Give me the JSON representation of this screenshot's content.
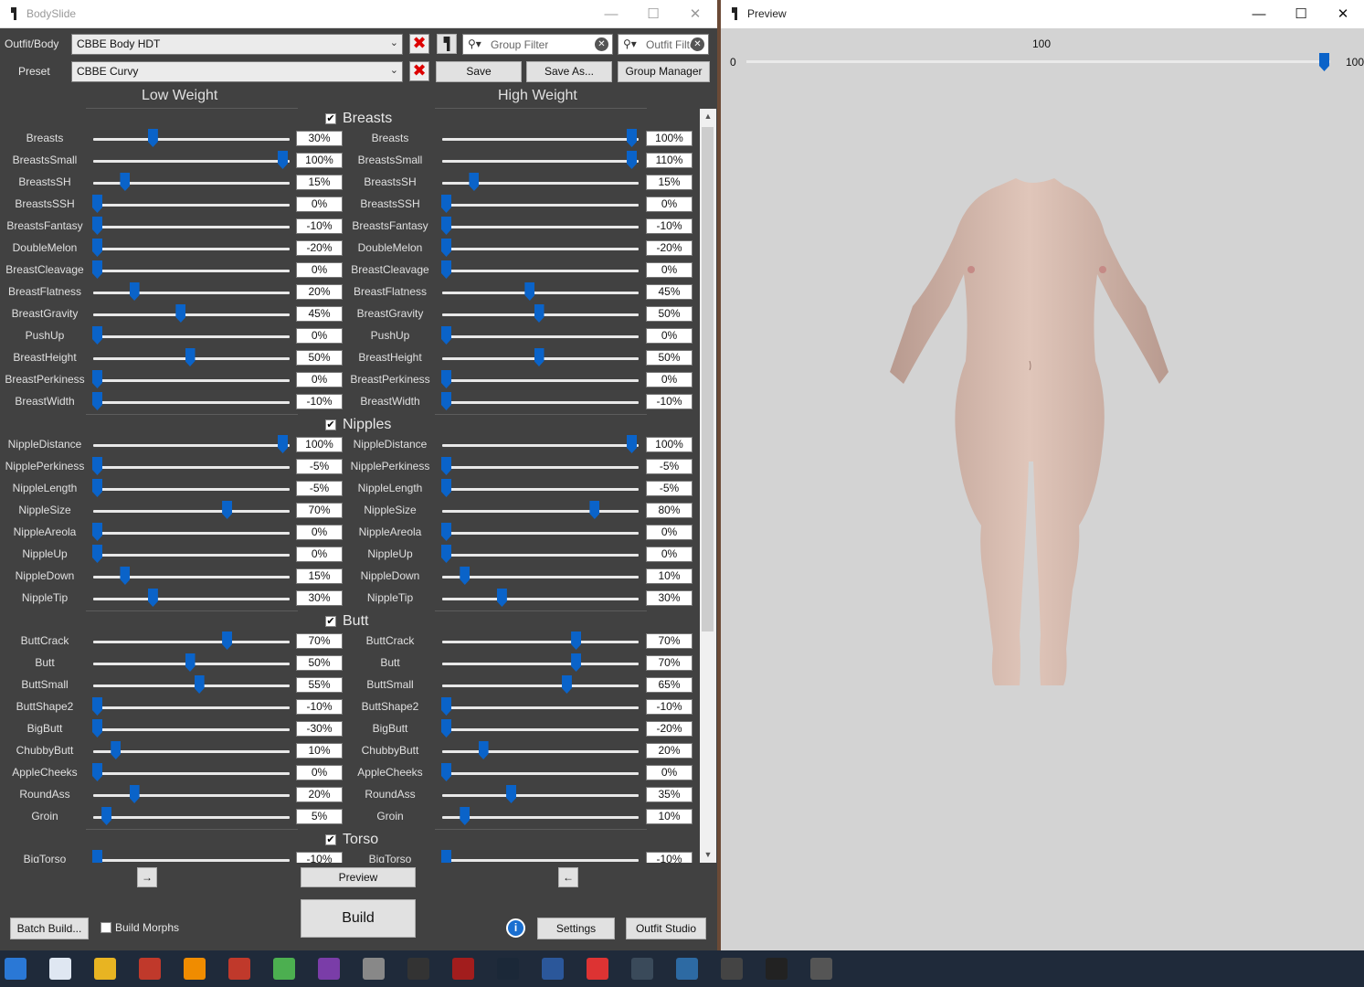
{
  "bodyslide": {
    "title": "BodySlide",
    "outfit_label": "Outfit/Body",
    "outfit_value": "CBBE Body HDT",
    "preset_label": "Preset",
    "preset_value": "CBBE Curvy",
    "group_filter_placeholder": "Group Filter",
    "outfit_filter_placeholder": "Outfit Filter",
    "save": "Save",
    "save_as": "Save As...",
    "group_manager": "Group Manager",
    "low_weight": "Low Weight",
    "high_weight": "High Weight",
    "preview_button": "Preview",
    "build_button": "Build",
    "batch_build": "Batch Build...",
    "build_morphs": "Build Morphs",
    "settings": "Settings",
    "outfit_studio": "Outfit Studio",
    "arrow_right": "→",
    "arrow_left": "←",
    "info": "i"
  },
  "sections": [
    {
      "name": "Breasts",
      "sliders": [
        {
          "name": "Breasts",
          "low": 30,
          "high": 100
        },
        {
          "name": "BreastsSmall",
          "low": 100,
          "high": 110
        },
        {
          "name": "BreastsSH",
          "low": 15,
          "high": 15
        },
        {
          "name": "BreastsSSH",
          "low": 0,
          "high": 0
        },
        {
          "name": "BreastsFantasy",
          "low": -10,
          "high": -10
        },
        {
          "name": "DoubleMelon",
          "low": -20,
          "high": -20
        },
        {
          "name": "BreastCleavage",
          "low": 0,
          "high": 0
        },
        {
          "name": "BreastFlatness",
          "low": 20,
          "high": 45
        },
        {
          "name": "BreastGravity",
          "low": 45,
          "high": 50
        },
        {
          "name": "PushUp",
          "low": 0,
          "high": 0
        },
        {
          "name": "BreastHeight",
          "low": 50,
          "high": 50
        },
        {
          "name": "BreastPerkiness",
          "low": 0,
          "high": 0
        },
        {
          "name": "BreastWidth",
          "low": -10,
          "high": -10
        }
      ]
    },
    {
      "name": "Nipples",
      "sliders": [
        {
          "name": "NippleDistance",
          "low": 100,
          "high": 100
        },
        {
          "name": "NipplePerkiness",
          "low": -5,
          "high": -5
        },
        {
          "name": "NippleLength",
          "low": -5,
          "high": -5
        },
        {
          "name": "NippleSize",
          "low": 70,
          "high": 80
        },
        {
          "name": "NippleAreola",
          "low": 0,
          "high": 0
        },
        {
          "name": "NippleUp",
          "low": 0,
          "high": 0
        },
        {
          "name": "NippleDown",
          "low": 15,
          "high": 10
        },
        {
          "name": "NippleTip",
          "low": 30,
          "high": 30
        }
      ]
    },
    {
      "name": "Butt",
      "sliders": [
        {
          "name": "ButtCrack",
          "low": 70,
          "high": 70
        },
        {
          "name": "Butt",
          "low": 50,
          "high": 70
        },
        {
          "name": "ButtSmall",
          "low": 55,
          "high": 65
        },
        {
          "name": "ButtShape2",
          "low": -10,
          "high": -10
        },
        {
          "name": "BigButt",
          "low": -30,
          "high": -20
        },
        {
          "name": "ChubbyButt",
          "low": 10,
          "high": 20
        },
        {
          "name": "AppleCheeks",
          "low": 0,
          "high": 0
        },
        {
          "name": "RoundAss",
          "low": 20,
          "high": 35
        },
        {
          "name": "Groin",
          "low": 5,
          "high": 10
        }
      ]
    },
    {
      "name": "Torso",
      "sliders": [
        {
          "name": "BigTorso",
          "low": -10,
          "high": -10
        }
      ]
    }
  ],
  "preview": {
    "title": "Preview",
    "weight_min": "0",
    "weight_max": "100",
    "weight_value": "100",
    "weight_fraction": 1.0
  },
  "taskbar": {
    "icons": [
      "explorer-icon",
      "notepad-icon",
      "file-explorer-icon",
      "firefox-icon",
      "vlc-icon",
      "app-icon",
      "utorrent-icon",
      "winrar-icon",
      "clock-tool-icon",
      "assassin-icon",
      "bethesda-icon",
      "steam-icon",
      "word-icon",
      "rubiks-icon",
      "wows-icon",
      "game-icon",
      "wot-icon",
      "mo2-icon",
      "bodyslide-icon"
    ]
  }
}
